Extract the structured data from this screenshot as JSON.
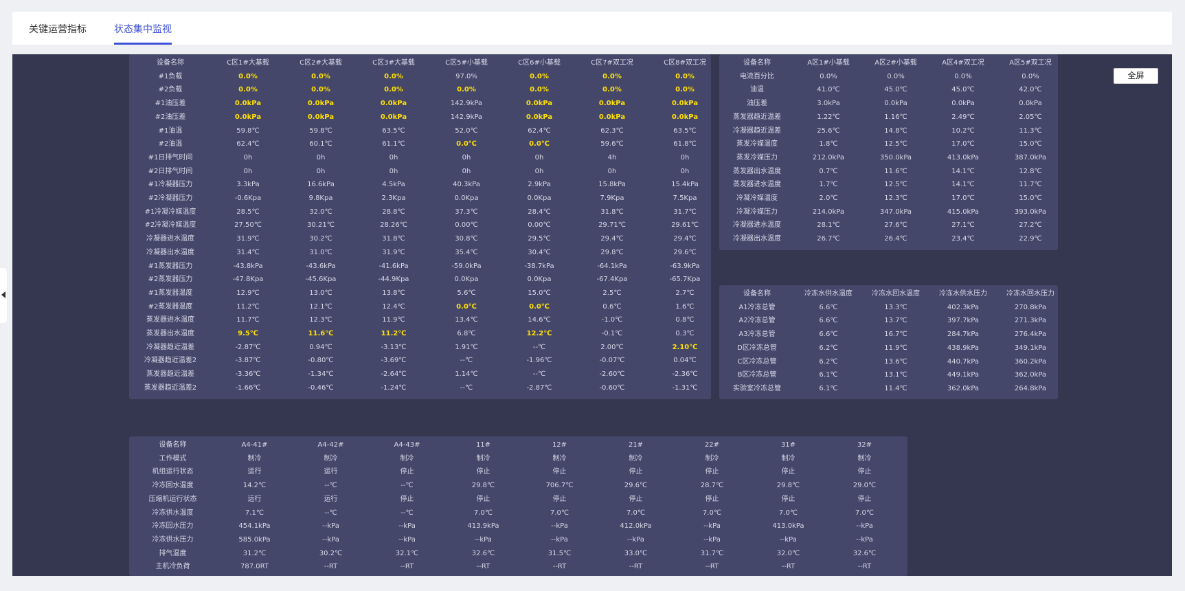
{
  "tabs": [
    {
      "label": "关键运营指标",
      "active": false
    },
    {
      "label": "状态集中监视",
      "active": true
    }
  ],
  "fullscreen_label": "全屏",
  "colors": {
    "accent": "#3f51d6",
    "board": "#35364f",
    "panel": "#44466a",
    "highlight": "#ffe000"
  },
  "table_c": {
    "rows": [
      [
        "设备名称",
        "C区1#大基载",
        "C区2#大基载",
        "C区3#大基载",
        "C区5#小基载",
        "C区6#小基载",
        "C区7#双工况",
        "C区8#双工况"
      ],
      [
        "#1负载",
        "0.0%",
        "0.0%",
        "0.0%",
        "97.0%",
        "0.0%",
        "0.0%",
        "0.0%"
      ],
      [
        "#2负载",
        "0.0%",
        "0.0%",
        "0.0%",
        "0.0%",
        "0.0%",
        "0.0%",
        "0.0%"
      ],
      [
        "#1油压差",
        "0.0kPa",
        "0.0kPa",
        "0.0kPa",
        "142.9kPa",
        "0.0kPa",
        "0.0kPa",
        "0.0kPa"
      ],
      [
        "#2油压差",
        "0.0kPa",
        "0.0kPa",
        "0.0kPa",
        "142.9kPa",
        "0.0kPa",
        "0.0kPa",
        "0.0kPa"
      ],
      [
        "#1油温",
        "59.8℃",
        "59.8℃",
        "63.5℃",
        "52.0℃",
        "62.4℃",
        "62.3℃",
        "63.5℃"
      ],
      [
        "#2油温",
        "62.4℃",
        "60.1℃",
        "61.1℃",
        "0.0℃",
        "0.0℃",
        "59.6℃",
        "61.8℃"
      ],
      [
        "#1日排气时间",
        "0h",
        "0h",
        "0h",
        "0h",
        "0h",
        "4h",
        "0h"
      ],
      [
        "#2日排气时间",
        "0h",
        "0h",
        "0h",
        "0h",
        "0h",
        "0h",
        "0h"
      ],
      [
        "#1冷凝器压力",
        "3.3kPa",
        "16.6kPa",
        "4.5kPa",
        "40.3kPa",
        "2.9kPa",
        "15.8kPa",
        "15.4kPa"
      ],
      [
        "#2冷凝器压力",
        "-0.6Kpa",
        "9.8Kpa",
        "2.3Kpa",
        "0.0Kpa",
        "0.0Kpa",
        "7.9Kpa",
        "7.5Kpa"
      ],
      [
        "#1冷凝冷媒温度",
        "28.5℃",
        "32.0℃",
        "28.8℃",
        "37.3℃",
        "28.4℃",
        "31.8℃",
        "31.7℃"
      ],
      [
        "#2冷凝冷媒温度",
        "27.50℃",
        "30.21℃",
        "28.26℃",
        "0.00℃",
        "0.00℃",
        "29.71℃",
        "29.61℃"
      ],
      [
        "冷凝器进水温度",
        "31.9℃",
        "30.2℃",
        "31.8℃",
        "30.8℃",
        "29.5℃",
        "29.4℃",
        "29.4℃"
      ],
      [
        "冷凝器出水温度",
        "31.4℃",
        "31.0℃",
        "31.9℃",
        "35.4℃",
        "30.4℃",
        "29.8℃",
        "29.6℃"
      ],
      [
        "#1蒸发器压力",
        "-43.8kPa",
        "-43.6kPa",
        "-41.6kPa",
        "-59.0kPa",
        "-38.7kPa",
        "-64.1kPa",
        "-63.9kPa"
      ],
      [
        "#2蒸发器压力",
        "-47.8Kpa",
        "-45.6Kpa",
        "-44.9Kpa",
        "0.0Kpa",
        "0.0Kpa",
        "-67.4Kpa",
        "-65.7Kpa"
      ],
      [
        "#1蒸发器温度",
        "12.9℃",
        "13.0℃",
        "13.8℃",
        "5.6℃",
        "15.0℃",
        "2.5℃",
        "2.7℃"
      ],
      [
        "#2蒸发器温度",
        "11.2℃",
        "12.1℃",
        "12.4℃",
        "0.0℃",
        "0.0℃",
        "0.6℃",
        "1.6℃"
      ],
      [
        "蒸发器进水温度",
        "11.7℃",
        "12.3℃",
        "11.9℃",
        "13.4℃",
        "14.6℃",
        "-1.0℃",
        "0.8℃"
      ],
      [
        "蒸发器出水温度",
        "9.5℃",
        "11.6℃",
        "11.2℃",
        "6.8℃",
        "12.2℃",
        "-0.1℃",
        "0.3℃"
      ],
      [
        "冷凝器趋近温差",
        "-2.87℃",
        "0.94℃",
        "-3.13℃",
        "1.91℃",
        "--℃",
        "2.00℃",
        "2.10℃"
      ],
      [
        "冷凝器趋近温差2",
        "-3.87℃",
        "-0.80℃",
        "-3.69℃",
        "--℃",
        "-1.96℃",
        "-0.07℃",
        "0.04℃"
      ],
      [
        "蒸发器趋近温差",
        "-3.36℃",
        "-1.34℃",
        "-2.64℃",
        "1.14℃",
        "--℃",
        "-2.60℃",
        "-2.36℃"
      ],
      [
        "蒸发器趋近温差2",
        "-1.66℃",
        "-0.46℃",
        "-1.24℃",
        "--℃",
        "-2.87℃",
        "-0.60℃",
        "-1.31℃"
      ]
    ],
    "highlight": [
      [
        1,
        1
      ],
      [
        1,
        2
      ],
      [
        1,
        3
      ],
      [
        1,
        5
      ],
      [
        1,
        6
      ],
      [
        1,
        7
      ],
      [
        2,
        1
      ],
      [
        2,
        2
      ],
      [
        2,
        3
      ],
      [
        2,
        4
      ],
      [
        2,
        5
      ],
      [
        2,
        6
      ],
      [
        2,
        7
      ],
      [
        3,
        1
      ],
      [
        3,
        2
      ],
      [
        3,
        3
      ],
      [
        3,
        5
      ],
      [
        3,
        6
      ],
      [
        3,
        7
      ],
      [
        4,
        1
      ],
      [
        4,
        2
      ],
      [
        4,
        3
      ],
      [
        4,
        5
      ],
      [
        4,
        6
      ],
      [
        4,
        7
      ],
      [
        6,
        4
      ],
      [
        6,
        5
      ],
      [
        18,
        4
      ],
      [
        18,
        5
      ],
      [
        20,
        1
      ],
      [
        20,
        2
      ],
      [
        20,
        3
      ],
      [
        20,
        5
      ],
      [
        21,
        7
      ]
    ]
  },
  "table_a": {
    "rows": [
      [
        "设备名称",
        "A区1#小基载",
        "A区2#小基载",
        "A区4#双工况",
        "A区5#双工况"
      ],
      [
        "电流百分比",
        "0.0%",
        "0.0%",
        "0.0%",
        "0.0%"
      ],
      [
        "油温",
        "41.0℃",
        "45.0℃",
        "45.0℃",
        "42.0℃"
      ],
      [
        "油压差",
        "3.0kPa",
        "0.0kPa",
        "0.0kPa",
        "0.0kPa"
      ],
      [
        "蒸发器趋近温差",
        "1.22℃",
        "1.16℃",
        "2.49℃",
        "2.05℃"
      ],
      [
        "冷凝器趋近温差",
        "25.6℃",
        "14.8℃",
        "10.2℃",
        "11.3℃"
      ],
      [
        "蒸发冷媒温度",
        "1.8℃",
        "12.5℃",
        "17.0℃",
        "15.0℃"
      ],
      [
        "蒸发冷媒压力",
        "212.0kPa",
        "350.0kPa",
        "413.0kPa",
        "387.0kPa"
      ],
      [
        "蒸发器出水温度",
        "0.7℃",
        "11.6℃",
        "14.1℃",
        "12.8℃"
      ],
      [
        "蒸发器进水温度",
        "1.7℃",
        "12.5℃",
        "14.1℃",
        "11.7℃"
      ],
      [
        "冷凝冷媒温度",
        "2.0℃",
        "12.3℃",
        "17.0℃",
        "15.0℃"
      ],
      [
        "冷凝冷媒压力",
        "214.0kPa",
        "347.0kPa",
        "415.0kPa",
        "393.0kPa"
      ],
      [
        "冷凝器进水温度",
        "28.1℃",
        "27.6℃",
        "27.1℃",
        "27.2℃"
      ],
      [
        "冷凝器出水温度",
        "26.7℃",
        "26.4℃",
        "23.4℃",
        "22.9℃"
      ]
    ],
    "highlight": []
  },
  "table_pipe": {
    "rows": [
      [
        "设备名称",
        "冷冻水供水温度",
        "冷冻水回水温度",
        "冷冻水供水压力",
        "冷冻水回水压力"
      ],
      [
        "A1冷冻总管",
        "6.6℃",
        "13.3℃",
        "402.3kPa",
        "270.8kPa"
      ],
      [
        "A2冷冻总管",
        "6.6℃",
        "13.7℃",
        "397.7kPa",
        "271.3kPa"
      ],
      [
        "A3冷冻总管",
        "6.6℃",
        "16.7℃",
        "284.7kPa",
        "276.4kPa"
      ],
      [
        "D区冷冻总管",
        "6.2℃",
        "11.9℃",
        "438.9kPa",
        "349.1kPa"
      ],
      [
        "C区冷冻总管",
        "6.2℃",
        "13.6℃",
        "440.7kPa",
        "360.2kPa"
      ],
      [
        "B区冷冻总管",
        "6.1℃",
        "13.1℃",
        "449.1kPa",
        "362.0kPa"
      ],
      [
        "实验室冷冻总管",
        "6.1℃",
        "11.4℃",
        "362.0kPa",
        "264.8kPa"
      ]
    ],
    "highlight": []
  },
  "table_units": {
    "rows": [
      [
        "设备名称",
        "A4-41#",
        "A4-42#",
        "A4-43#",
        "11#",
        "12#",
        "21#",
        "22#",
        "31#",
        "32#"
      ],
      [
        "工作模式",
        "制冷",
        "制冷",
        "制冷",
        "制冷",
        "制冷",
        "制冷",
        "制冷",
        "制冷",
        "制冷"
      ],
      [
        "机组运行状态",
        "运行",
        "运行",
        "停止",
        "停止",
        "停止",
        "停止",
        "停止",
        "停止",
        "停止"
      ],
      [
        "冷冻回水温度",
        "14.2℃",
        "--℃",
        "--℃",
        "29.8℃",
        "706.7℃",
        "29.6℃",
        "28.7℃",
        "29.8℃",
        "29.0℃"
      ],
      [
        "压缩机运行状态",
        "运行",
        "运行",
        "停止",
        "停止",
        "停止",
        "停止",
        "停止",
        "停止",
        "停止"
      ],
      [
        "冷冻供水温度",
        "7.1℃",
        "--℃",
        "--℃",
        "7.0℃",
        "7.0℃",
        "7.0℃",
        "7.0℃",
        "7.0℃",
        "7.0℃"
      ],
      [
        "冷冻回水压力",
        "454.1kPa",
        "--kPa",
        "--kPa",
        "413.9kPa",
        "--kPa",
        "412.0kPa",
        "--kPa",
        "413.0kPa",
        "--kPa"
      ],
      [
        "冷冻供水压力",
        "585.0kPa",
        "--kPa",
        "--kPa",
        "--kPa",
        "--kPa",
        "--kPa",
        "--kPa",
        "--kPa",
        "--kPa"
      ],
      [
        "排气温度",
        "31.2℃",
        "30.2℃",
        "32.1℃",
        "32.6℃",
        "31.5℃",
        "33.0℃",
        "31.7℃",
        "32.0℃",
        "32.6℃"
      ],
      [
        "主机冷负荷",
        "787.0RT",
        "--RT",
        "--RT",
        "--RT",
        "--RT",
        "--RT",
        "--RT",
        "--RT",
        "--RT"
      ]
    ],
    "highlight": []
  }
}
